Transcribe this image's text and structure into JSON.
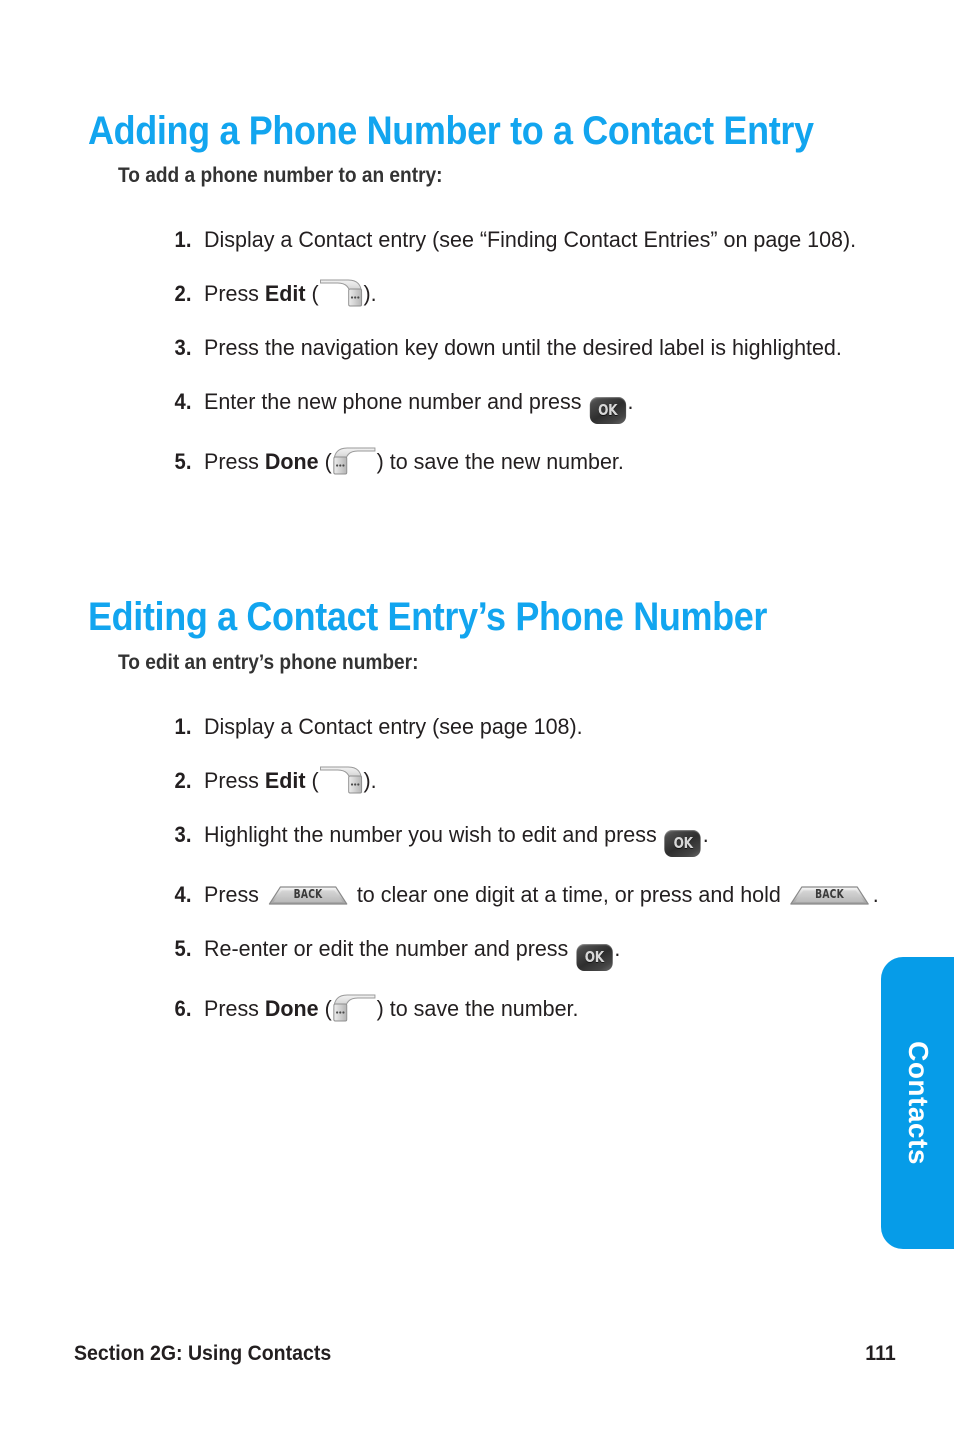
{
  "page": {
    "number": "111",
    "footer_section": "Section 2G: Using Contacts",
    "side_tab_label": "Contacts",
    "heading_color": "#12a5ef",
    "side_tab_color": "#069ce8"
  },
  "sections": [
    {
      "heading": "Adding a Phone Number to a Contact Entry",
      "subheading": "To add a phone number to an entry:",
      "steps": [
        {
          "num": "1.",
          "parts": [
            {
              "t": "text",
              "v": "Display a Contact entry (see “Finding Contact Entries” on page 108)."
            }
          ]
        },
        {
          "num": "2.",
          "parts": [
            {
              "t": "text",
              "v": "Press "
            },
            {
              "t": "bold",
              "v": "Edit"
            },
            {
              "t": "text",
              "v": " ("
            },
            {
              "t": "icon",
              "v": "soft-key-right-icon"
            },
            {
              "t": "text",
              "v": ")."
            }
          ]
        },
        {
          "num": "3.",
          "parts": [
            {
              "t": "text",
              "v": "Press the navigation key down until the desired label is highlighted."
            }
          ]
        },
        {
          "num": "4.",
          "parts": [
            {
              "t": "text",
              "v": "Enter the new phone number and press "
            },
            {
              "t": "icon",
              "v": "ok-key-icon"
            },
            {
              "t": "text",
              "v": "."
            }
          ]
        },
        {
          "num": "5.",
          "parts": [
            {
              "t": "text",
              "v": "Press "
            },
            {
              "t": "bold",
              "v": "Done"
            },
            {
              "t": "text",
              "v": " ("
            },
            {
              "t": "icon",
              "v": "soft-key-left-icon"
            },
            {
              "t": "text",
              "v": ") to save the new number."
            }
          ]
        }
      ]
    },
    {
      "heading": "Editing a Contact Entry’s Phone Number",
      "subheading": "To edit an entry’s phone number:",
      "steps": [
        {
          "num": "1.",
          "parts": [
            {
              "t": "text",
              "v": "Display a Contact entry (see page 108)."
            }
          ]
        },
        {
          "num": "2.",
          "parts": [
            {
              "t": "text",
              "v": "Press "
            },
            {
              "t": "bold",
              "v": "Edit"
            },
            {
              "t": "text",
              "v": " ("
            },
            {
              "t": "icon",
              "v": "soft-key-right-icon"
            },
            {
              "t": "text",
              "v": ")."
            }
          ]
        },
        {
          "num": "3.",
          "parts": [
            {
              "t": "text",
              "v": "Highlight the number you wish to edit and press "
            },
            {
              "t": "icon",
              "v": "ok-key-icon"
            },
            {
              "t": "text",
              "v": "."
            }
          ]
        },
        {
          "num": "4.",
          "parts": [
            {
              "t": "text",
              "v": "Press "
            },
            {
              "t": "icon",
              "v": "back-key-icon"
            },
            {
              "t": "text",
              "v": " to clear one digit at a time, or press and hold "
            },
            {
              "t": "icon",
              "v": "back-key-icon"
            },
            {
              "t": "text",
              "v": "."
            }
          ]
        },
        {
          "num": "5.",
          "parts": [
            {
              "t": "text",
              "v": "Re-enter or edit the number and press "
            },
            {
              "t": "icon",
              "v": "ok-key-icon"
            },
            {
              "t": "text",
              "v": "."
            }
          ]
        },
        {
          "num": "6.",
          "parts": [
            {
              "t": "text",
              "v": "Press "
            },
            {
              "t": "bold",
              "v": "Done"
            },
            {
              "t": "text",
              "v": " ("
            },
            {
              "t": "icon",
              "v": "soft-key-left-icon"
            },
            {
              "t": "text",
              "v": ") to save the number."
            }
          ]
        }
      ]
    }
  ],
  "icons": {
    "ok_key_label": "OK",
    "back_key_label": "BACK",
    "soft_key_dots": "•••"
  }
}
